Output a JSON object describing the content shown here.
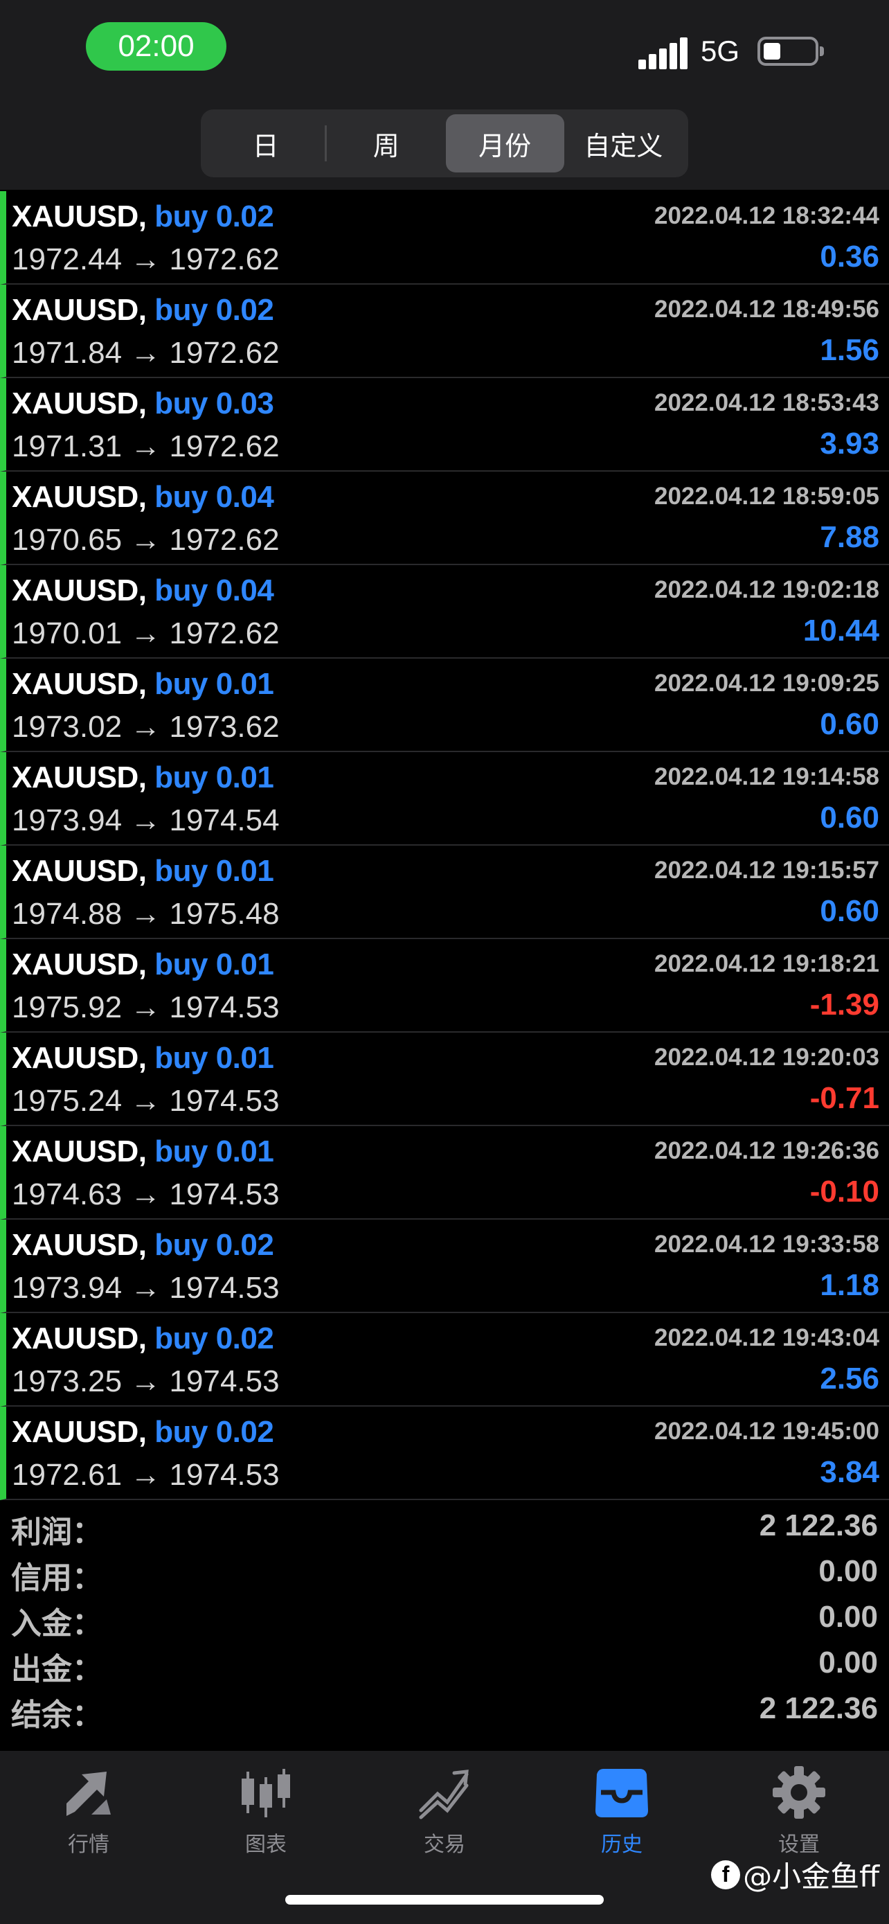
{
  "status_bar": {
    "time": "02:00",
    "network": "5G"
  },
  "period_tabs": [
    {
      "label": "日",
      "active": false
    },
    {
      "label": "周",
      "active": false
    },
    {
      "label": "月份",
      "active": true
    },
    {
      "label": "自定义",
      "active": false
    }
  ],
  "deals": [
    {
      "symbol": "XAUUSD,",
      "side": "buy 0.02",
      "open": "1972.44",
      "close": "1972.62",
      "time": "2022.04.12 18:32:44",
      "profit": "0.36",
      "negative": false
    },
    {
      "symbol": "XAUUSD,",
      "side": "buy 0.02",
      "open": "1971.84",
      "close": "1972.62",
      "time": "2022.04.12 18:49:56",
      "profit": "1.56",
      "negative": false
    },
    {
      "symbol": "XAUUSD,",
      "side": "buy 0.03",
      "open": "1971.31",
      "close": "1972.62",
      "time": "2022.04.12 18:53:43",
      "profit": "3.93",
      "negative": false
    },
    {
      "symbol": "XAUUSD,",
      "side": "buy 0.04",
      "open": "1970.65",
      "close": "1972.62",
      "time": "2022.04.12 18:59:05",
      "profit": "7.88",
      "negative": false
    },
    {
      "symbol": "XAUUSD,",
      "side": "buy 0.04",
      "open": "1970.01",
      "close": "1972.62",
      "time": "2022.04.12 19:02:18",
      "profit": "10.44",
      "negative": false
    },
    {
      "symbol": "XAUUSD,",
      "side": "buy 0.01",
      "open": "1973.02",
      "close": "1973.62",
      "time": "2022.04.12 19:09:25",
      "profit": "0.60",
      "negative": false
    },
    {
      "symbol": "XAUUSD,",
      "side": "buy 0.01",
      "open": "1973.94",
      "close": "1974.54",
      "time": "2022.04.12 19:14:58",
      "profit": "0.60",
      "negative": false
    },
    {
      "symbol": "XAUUSD,",
      "side": "buy 0.01",
      "open": "1974.88",
      "close": "1975.48",
      "time": "2022.04.12 19:15:57",
      "profit": "0.60",
      "negative": false
    },
    {
      "symbol": "XAUUSD,",
      "side": "buy 0.01",
      "open": "1975.92",
      "close": "1974.53",
      "time": "2022.04.12 19:18:21",
      "profit": "-1.39",
      "negative": true
    },
    {
      "symbol": "XAUUSD,",
      "side": "buy 0.01",
      "open": "1975.24",
      "close": "1974.53",
      "time": "2022.04.12 19:20:03",
      "profit": "-0.71",
      "negative": true
    },
    {
      "symbol": "XAUUSD,",
      "side": "buy 0.01",
      "open": "1974.63",
      "close": "1974.53",
      "time": "2022.04.12 19:26:36",
      "profit": "-0.10",
      "negative": true
    },
    {
      "symbol": "XAUUSD,",
      "side": "buy 0.02",
      "open": "1973.94",
      "close": "1974.53",
      "time": "2022.04.12 19:33:58",
      "profit": "1.18",
      "negative": false
    },
    {
      "symbol": "XAUUSD,",
      "side": "buy 0.02",
      "open": "1973.25",
      "close": "1974.53",
      "time": "2022.04.12 19:43:04",
      "profit": "2.56",
      "negative": false
    },
    {
      "symbol": "XAUUSD,",
      "side": "buy 0.02",
      "open": "1972.61",
      "close": "1974.53",
      "time": "2022.04.12 19:45:00",
      "profit": "3.84",
      "negative": false
    }
  ],
  "arrow": "→",
  "summary": [
    {
      "label": "利润：",
      "value": "2 122.36"
    },
    {
      "label": "信用：",
      "value": "0.00"
    },
    {
      "label": "入金：",
      "value": "0.00"
    },
    {
      "label": "出金：",
      "value": "0.00"
    },
    {
      "label": "结余：",
      "value": "2 122.36"
    }
  ],
  "tabbar": [
    {
      "label": "行情",
      "icon": "quotes-icon",
      "active": false
    },
    {
      "label": "图表",
      "icon": "candlestick-chart-icon",
      "active": false
    },
    {
      "label": "交易",
      "icon": "trade-icon",
      "active": false
    },
    {
      "label": "历史",
      "icon": "history-inbox-icon",
      "active": true
    },
    {
      "label": "设置",
      "icon": "gear-icon",
      "active": false
    }
  ],
  "watermark": {
    "fb": "f",
    "text": "@小金鱼ff"
  },
  "colors": {
    "buy": "#2f87ff",
    "profit_positive": "#2f87ff",
    "profit_negative": "#ff3b30",
    "row_indicator": "#2ecc40",
    "time_pill": "#30c74b"
  }
}
